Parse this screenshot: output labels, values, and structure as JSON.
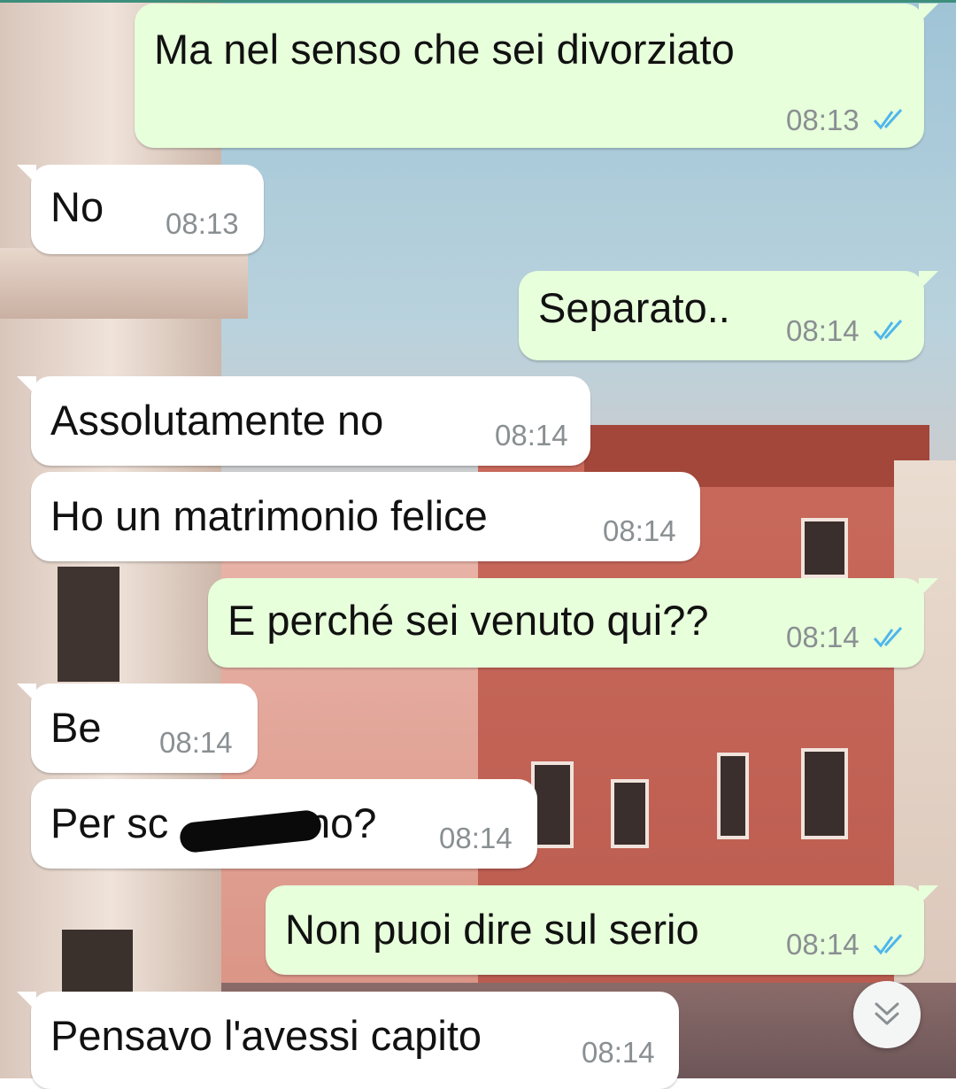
{
  "messages": [
    {
      "direction": "out",
      "text": "Ma nel senso che sei divorziato",
      "time": "08:13",
      "status": "read"
    },
    {
      "direction": "in",
      "text": "No",
      "time": "08:13"
    },
    {
      "direction": "out",
      "text": "Separato..",
      "time": "08:14",
      "status": "read"
    },
    {
      "direction": "in",
      "text": "Assolutamente no",
      "time": "08:14"
    },
    {
      "direction": "in",
      "text": "Ho un matrimonio felice",
      "time": "08:14"
    },
    {
      "direction": "out",
      "text": "E perché sei venuto qui??",
      "time": "08:14",
      "status": "read"
    },
    {
      "direction": "in",
      "text": "Be",
      "time": "08:14"
    },
    {
      "direction": "in",
      "text": "Per sc",
      "text_after_redaction": "no?",
      "time": "08:14",
      "redacted": true
    },
    {
      "direction": "out",
      "text": "Non puoi dire sul serio",
      "time": "08:14",
      "status": "read"
    },
    {
      "direction": "in",
      "text": "Pensavo l'avessi capito",
      "time": "08:14"
    }
  ],
  "controls": {
    "scroll_down_icon": "double-chevron-down-icon"
  },
  "colors": {
    "outgoing_bubble": "#e7ffdb",
    "incoming_bubble": "#ffffff",
    "read_ticks": "#4fb6ec",
    "timestamp": "#8a8f92"
  }
}
